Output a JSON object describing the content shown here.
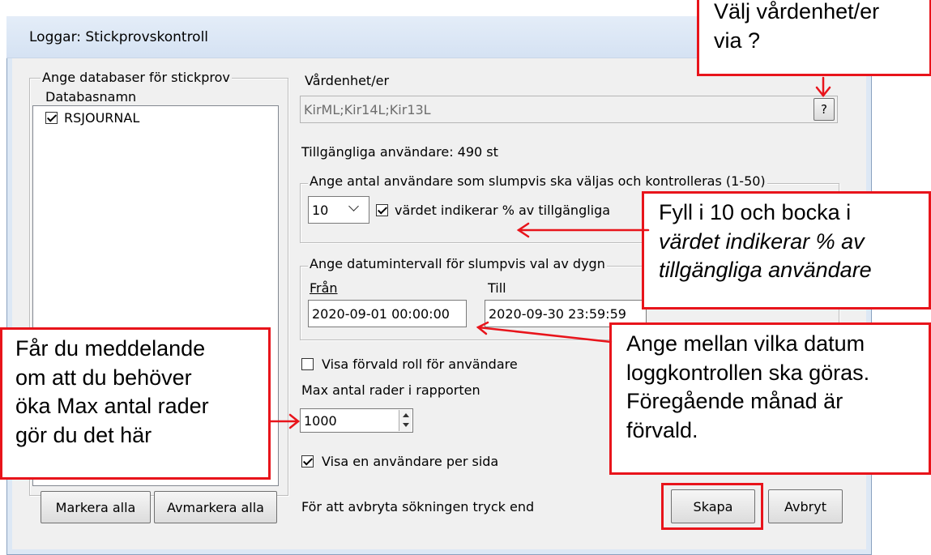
{
  "window": {
    "title": "Loggar: Stickprovskontroll"
  },
  "top_cutoff_text": "vjLoggar Stickprovskontroll Välj vårdenhet/er via ?",
  "databases": {
    "legend": "Ange databaser för stickprov",
    "column_header": "Databasnamn",
    "items": [
      {
        "name": "RSJOURNAL",
        "checked": true
      }
    ],
    "select_all": "Markera alla",
    "deselect_all": "Avmarkera alla"
  },
  "units": {
    "label": "Vårdenhet/er",
    "value": "KirML;Kir14L;Kir13L",
    "help_button": "?"
  },
  "available_users": "Tillgängliga användare: 490 st",
  "random_users": {
    "legend": "Ange antal användare som slumpvis ska väljas och kontrolleras (1-50)",
    "count": "10",
    "percent_label": "värdet indikerar % av tillgängliga",
    "percent_checked": true
  },
  "date_range": {
    "legend": "Ange datumintervall för slumpvis val av dygn",
    "from_label": "Från",
    "to_label": "Till",
    "from_value": "2020-09-01 00:00:00",
    "to_value": "2020-09-30 23:59:59"
  },
  "options": {
    "show_default_role": "Visa förvald roll för användare",
    "show_default_role_checked": false,
    "max_rows_label": "Max antal rader i rapporten",
    "max_rows_value": "1000",
    "one_user_per_page": "Visa en användare per sida",
    "one_user_per_page_checked": true
  },
  "footer": {
    "hint": "För att avbryta sökningen tryck end",
    "create": "Skapa",
    "cancel": "Avbryt"
  },
  "callouts": {
    "units_line1": "Välj vårdenhet/er",
    "units_line2": "via ?",
    "fill_line1": "Fyll i 10 och bocka i",
    "fill_line2": "värdet indikerar % av",
    "fill_line3": "tillgängliga användare",
    "dates_line1": "Ange mellan vilka datum",
    "dates_line2": "loggkontrollen ska göras.",
    "dates_line3": "Föregående månad är",
    "dates_line4": "förvald.",
    "maxrows_line1": "Får du meddelande",
    "maxrows_line2": "om att du behöver",
    "maxrows_line3": "öka Max antal rader",
    "maxrows_line4": "gör du det här"
  },
  "colors": {
    "accent_red": "#e8141b",
    "window_bg": "#f0f0f0"
  }
}
